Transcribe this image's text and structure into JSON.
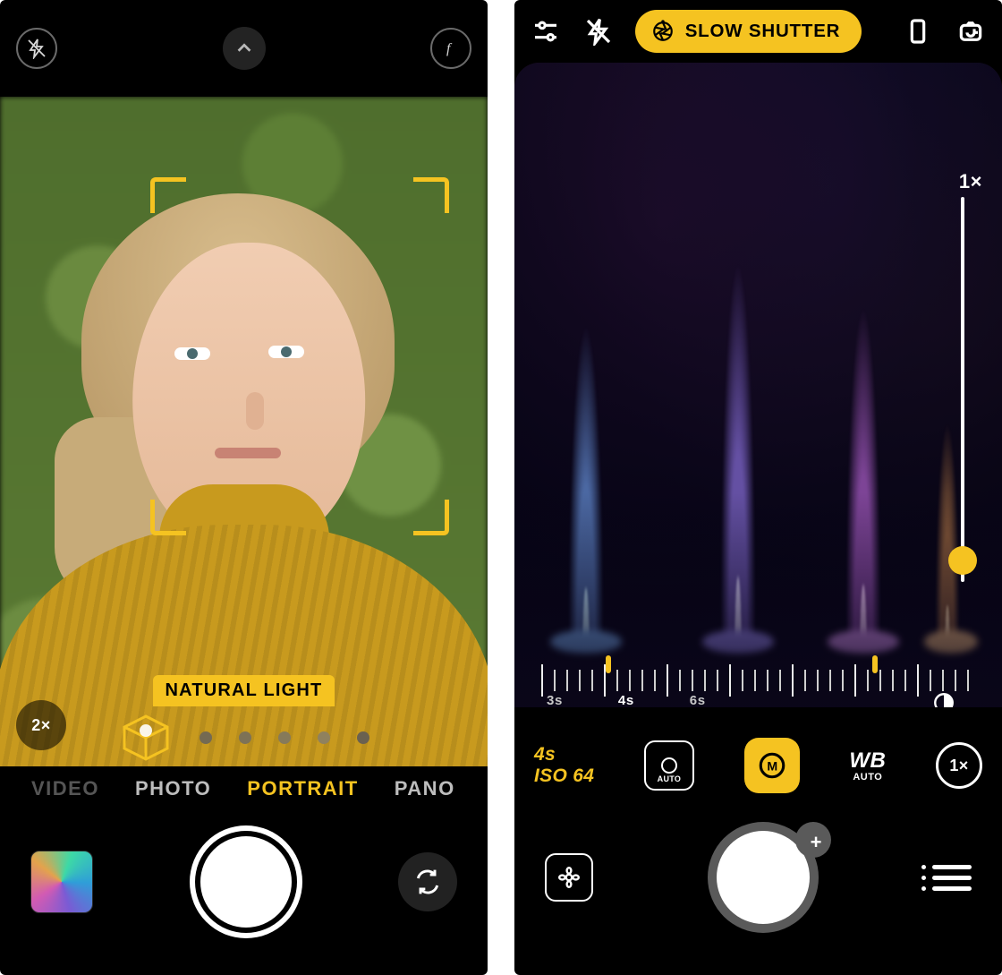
{
  "left": {
    "topbar": {
      "flash_icon": "flash-off-icon",
      "chevron_icon": "chevron-up-icon",
      "filter_icon": "f-aperture-icon"
    },
    "viewfinder": {
      "lighting_badge": "NATURAL LIGHT",
      "zoom_pill": "2×"
    },
    "modes": {
      "video": "VIDEO",
      "photo": "PHOTO",
      "portrait": "PORTRAIT",
      "pano": "PANO"
    },
    "dock": {
      "thumbnail": "last-photo-thumbnail",
      "shutter": "shutter-button",
      "flip": "switch-camera-icon"
    }
  },
  "right": {
    "topbar": {
      "sliders_icon": "settings-sliders-icon",
      "flash_icon": "flash-off-icon",
      "mode_pill": "SLOW SHUTTER",
      "orientation_icon": "phone-portrait-icon",
      "camera_switch_icon": "camera-rotate-icon"
    },
    "viewfinder": {
      "zoom_label": "1×",
      "ruler_labels": [
        "3s",
        "4s",
        "6s"
      ]
    },
    "controls": {
      "readout_line1": "4s",
      "readout_line2": "ISO 64",
      "focus_label": "AUTO",
      "wb_top": "WB",
      "wb_bottom": "AUTO",
      "zoom_ring": "1×"
    },
    "dock": {
      "gallery_icon": "gallery-flower-icon",
      "shutter": "shutter-button",
      "plus": "+",
      "menu_icon": "menu-list-icon"
    }
  }
}
